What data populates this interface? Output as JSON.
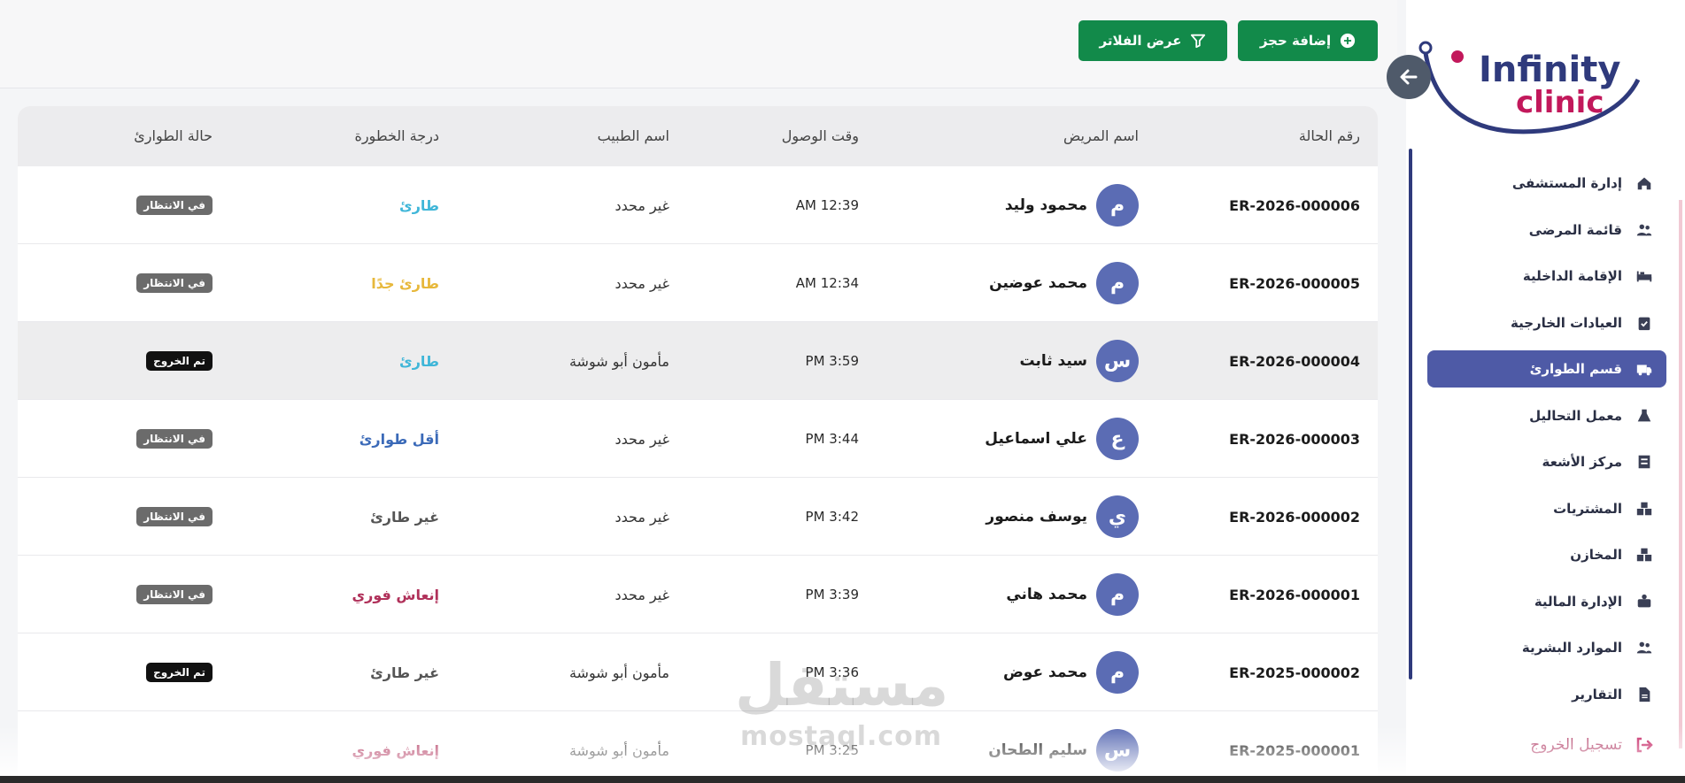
{
  "toolbar": {
    "add_booking_label": "إضافة حجز",
    "show_filters_label": "عرض الفلاتر"
  },
  "table": {
    "headers": {
      "case_no": "رقم الحالة",
      "patient": "اسم المريض",
      "arrival": "وقت الوصول",
      "doctor": "اسم الطبيب",
      "severity": "درجة الخطورة",
      "status": "حالة الطوارئ"
    },
    "rows": [
      {
        "case": "ER-2026-000006",
        "initial": "م",
        "patient": "محمود وليد",
        "time": "AM 12:39",
        "doctor": "غير محدد",
        "severity": "طارئ",
        "severity_color": "#3fb6d8",
        "status": "في الانتظار",
        "status_kind": "wait"
      },
      {
        "case": "ER-2026-000005",
        "initial": "م",
        "patient": "محمد عوضين",
        "time": "AM 12:34",
        "doctor": "غير محدد",
        "severity": "طارئ جدًا",
        "severity_color": "#e7b83b",
        "status": "في الانتظار",
        "status_kind": "wait"
      },
      {
        "case": "ER-2026-000004",
        "initial": "س",
        "patient": "سيد ثابت",
        "time": "PM 3:59",
        "doctor": "مأمون أبو شوشة",
        "severity": "طارئ",
        "severity_color": "#3fb6d8",
        "status": "تم الخروج",
        "status_kind": "out"
      },
      {
        "case": "ER-2026-000003",
        "initial": "ع",
        "patient": "علي اسماعيل",
        "time": "PM 3:44",
        "doctor": "غير محدد",
        "severity": "أقل طوارئ",
        "severity_color": "#3b6ab8",
        "status": "في الانتظار",
        "status_kind": "wait"
      },
      {
        "case": "ER-2026-000002",
        "initial": "ي",
        "patient": "يوسف منصور",
        "time": "PM 3:42",
        "doctor": "غير محدد",
        "severity": "غير طارئ",
        "severity_color": "#555555",
        "status": "في الانتظار",
        "status_kind": "wait"
      },
      {
        "case": "ER-2026-000001",
        "initial": "م",
        "patient": "محمد هاني",
        "time": "PM 3:39",
        "doctor": "غير محدد",
        "severity": "إنعاش فوري",
        "severity_color": "#b0315a",
        "status": "في الانتظار",
        "status_kind": "wait"
      },
      {
        "case": "ER-2025-000002",
        "initial": "م",
        "patient": "محمد عوض",
        "time": "PM 3:36",
        "doctor": "مأمون أبو شوشة",
        "severity": "غير طارئ",
        "severity_color": "#555555",
        "status": "تم الخروج",
        "status_kind": "out"
      },
      {
        "case": "ER-2025-000001",
        "initial": "س",
        "patient": "سليم الطحان",
        "time": "PM 3:25",
        "doctor": "مأمون أبو شوشة",
        "severity": "إنعاش فوري",
        "severity_color": "#b0315a",
        "status": "",
        "status_kind": "none"
      }
    ]
  },
  "brand": {
    "line1": "Infinity",
    "line2": "clinic",
    "primary_color": "#2f3a7c",
    "accent_color": "#c2185b"
  },
  "sidebar": {
    "items": [
      {
        "label": "إدارة المستشفى",
        "icon": "home-icon"
      },
      {
        "label": "قائمة المرضى",
        "icon": "users-icon"
      },
      {
        "label": "الإقامة الداخلية",
        "icon": "bed-icon"
      },
      {
        "label": "العيادات الخارجية",
        "icon": "clipboard-check-icon"
      },
      {
        "label": "قسم الطوارئ",
        "icon": "ambulance-icon",
        "active": true
      },
      {
        "label": "معمل التحاليل",
        "icon": "flask-icon"
      },
      {
        "label": "مركز الأشعة",
        "icon": "xray-icon"
      },
      {
        "label": "المشتريات",
        "icon": "boxes-icon"
      },
      {
        "label": "المخازن",
        "icon": "boxes-icon"
      },
      {
        "label": "الإدارة المالية",
        "icon": "money-icon"
      },
      {
        "label": "الموارد البشرية",
        "icon": "users-icon"
      },
      {
        "label": "التقارير",
        "icon": "report-icon"
      }
    ],
    "logout_label": "تسجيل الخروج"
  },
  "watermark": {
    "ar": "مستقل",
    "en": "mostaql.com"
  }
}
